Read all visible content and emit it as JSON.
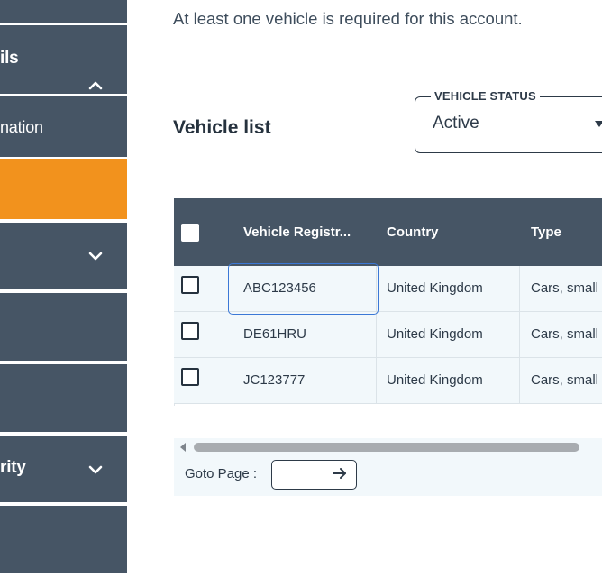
{
  "sidebar": {
    "items": [
      {
        "label": "",
        "icon": ""
      },
      {
        "label": "ils",
        "icon": "chevron-up-icon"
      },
      {
        "label": "nation",
        "icon": ""
      },
      {
        "label": "",
        "icon": "",
        "active": true
      },
      {
        "label": "",
        "icon": "chevron-down-icon"
      },
      {
        "label": "",
        "icon": ""
      },
      {
        "label": "",
        "icon": ""
      },
      {
        "label": "rity",
        "icon": "chevron-down-icon"
      },
      {
        "label": "",
        "icon": ""
      }
    ],
    "active_color": "#f2921d",
    "item_color": "#465565"
  },
  "notice": "At least one vehicle is required for this account.",
  "vehicle_list": {
    "title": "Vehicle list",
    "status_filter": {
      "legend": "VEHICLE STATUS",
      "value": "Active"
    },
    "columns": [
      "Vehicle Registr...",
      "Country",
      "Type"
    ],
    "rows": [
      {
        "registration": "ABC123456",
        "country": "United Kingdom",
        "type": "Cars, small"
      },
      {
        "registration": "DE61HRU",
        "country": "United Kingdom",
        "type": "Cars, small"
      },
      {
        "registration": "JC123777",
        "country": "United Kingdom",
        "type": "Cars, small"
      }
    ],
    "goto_page_label": "Goto Page :"
  }
}
